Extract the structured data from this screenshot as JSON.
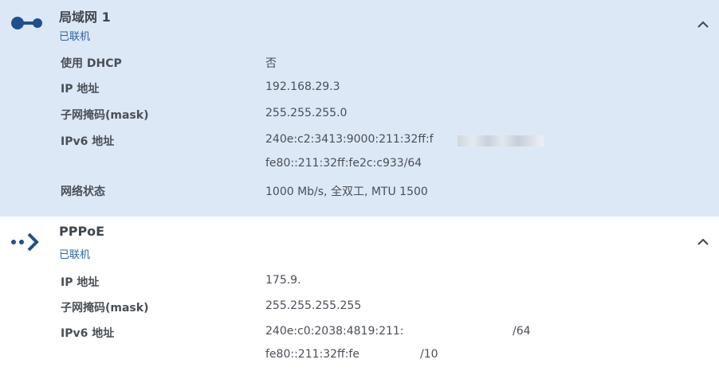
{
  "lan": {
    "title": "局域网 1",
    "status": "已联机",
    "icon": "lan-connected-icon",
    "colors": {
      "panel_bg": "#dde8f6",
      "accent": "#2b62a8"
    },
    "rows": [
      {
        "label": "使用 DHCP",
        "value": "否"
      },
      {
        "label": "IP 地址",
        "value": "192.168.29.3"
      },
      {
        "label": "子网掩码(mask)",
        "value": "255.255.255.0"
      },
      {
        "label": "IPv6 地址",
        "value": "240e:c2:3413:9000:211:32ff:f",
        "value2": "fe80::211:32ff:fe2c:c933/64"
      },
      {
        "label": "网络状态",
        "value": "1000 Mb/s, 全双工, MTU 1500"
      }
    ]
  },
  "pppoe": {
    "title": "PPPoE",
    "status": "已联机",
    "icon": "pppoe-connection-icon",
    "rows": [
      {
        "label": "IP 地址",
        "value": "175.9."
      },
      {
        "label": "子网掩码(mask)",
        "value": "255.255.255.255"
      },
      {
        "label": "IPv6 地址",
        "value": "240e:c0:2038:4819:211:",
        "value_suffix": "/64",
        "value2": "fe80::211:32ff:fe",
        "value2_suffix": "/10"
      }
    ]
  }
}
